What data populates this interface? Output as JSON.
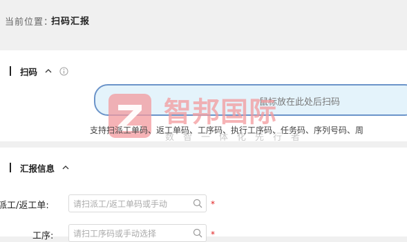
{
  "breadcrumb": {
    "label": "当前位置：",
    "current": "扫码汇报"
  },
  "scan_section": {
    "title": "扫码",
    "input_placeholder": "鼠标放在此处后扫码",
    "hint": "支持扫派工单码、返工单码、工序码、执行工序码、任务码、序列号码、周"
  },
  "watermark": {
    "title": "智邦国际",
    "slogan": "数智一体化先行者"
  },
  "report_section": {
    "title": "汇报信息",
    "fields": [
      {
        "label": "派工/返工单:",
        "placeholder": "请扫派工/返工单码或手动",
        "required": "*"
      },
      {
        "label": "工序:",
        "placeholder": "请扫工序码或手动选择",
        "required": "*"
      }
    ]
  },
  "colors": {
    "scan_border": "#6a93c9",
    "scan_bg": "#e4f3fb",
    "required": "#e02020"
  },
  "icons": [
    "chevron-up-icon",
    "info-icon",
    "search-icon"
  ]
}
